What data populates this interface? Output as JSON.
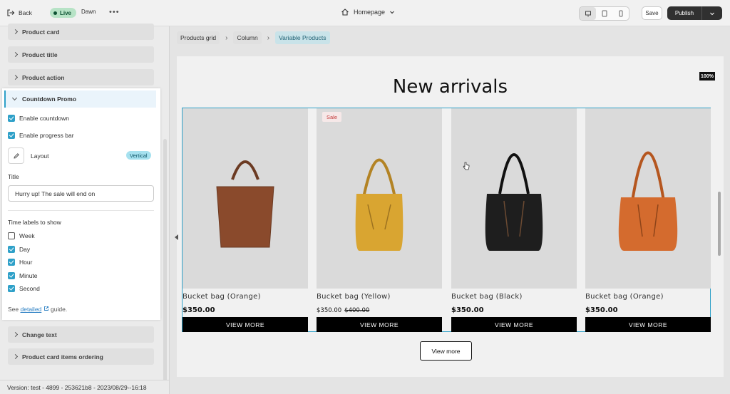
{
  "topbar": {
    "back_label": "Back",
    "live_label": "Live",
    "theme_name": "Dawn",
    "more_label": "•••",
    "page_selector": "Homepage",
    "save_label": "Save",
    "publish_label": "Publish"
  },
  "sidebar": {
    "collapsed_top": [
      "Product card",
      "Product title",
      "Product action"
    ],
    "collapsed_bottom": [
      "Change text",
      "Product card items ordering"
    ],
    "panel": {
      "title": "Countdown Promo",
      "enable_countdown": "Enable countdown",
      "enable_progress": "Enable progress bar",
      "layout_label": "Layout",
      "layout_value": "Vertical",
      "title_label": "Title",
      "title_value": "Hurry up! The sale will end on",
      "time_labels_heading": "Time labels to show",
      "time_labels": [
        {
          "label": "Week",
          "checked": false
        },
        {
          "label": "Day",
          "checked": true
        },
        {
          "label": "Hour",
          "checked": true
        },
        {
          "label": "Minute",
          "checked": true
        },
        {
          "label": "Second",
          "checked": true
        }
      ],
      "guide_prefix": "See",
      "guide_link": "detailed",
      "guide_suffix": "guide."
    }
  },
  "version_text": "Version: test - 4899 - 253621b8 - 2023/08/29--16:18",
  "breadcrumb": [
    "Products grid",
    "Column",
    "Variable Products"
  ],
  "preview": {
    "heading": "New arrivals",
    "zoom": "100%",
    "sale_badge": "Sale",
    "products": [
      {
        "name": "Bucket bag (Orange)",
        "price": "$350.00",
        "compare": "",
        "button": "VIEW MORE",
        "color": "#8a4a2c"
      },
      {
        "name": "Bucket bag (Yellow)",
        "price": "$350.00",
        "compare": "$400.00",
        "button": "VIEW MORE",
        "color": "#d9a531"
      },
      {
        "name": "Bucket bag (Black)",
        "price": "$350.00",
        "compare": "",
        "button": "VIEW MORE",
        "color": "#1e1e1e"
      },
      {
        "name": "Bucket bag (Orange)",
        "price": "$350.00",
        "compare": "",
        "button": "VIEW MORE",
        "color": "#d46b2e"
      }
    ],
    "view_more": "View more"
  }
}
